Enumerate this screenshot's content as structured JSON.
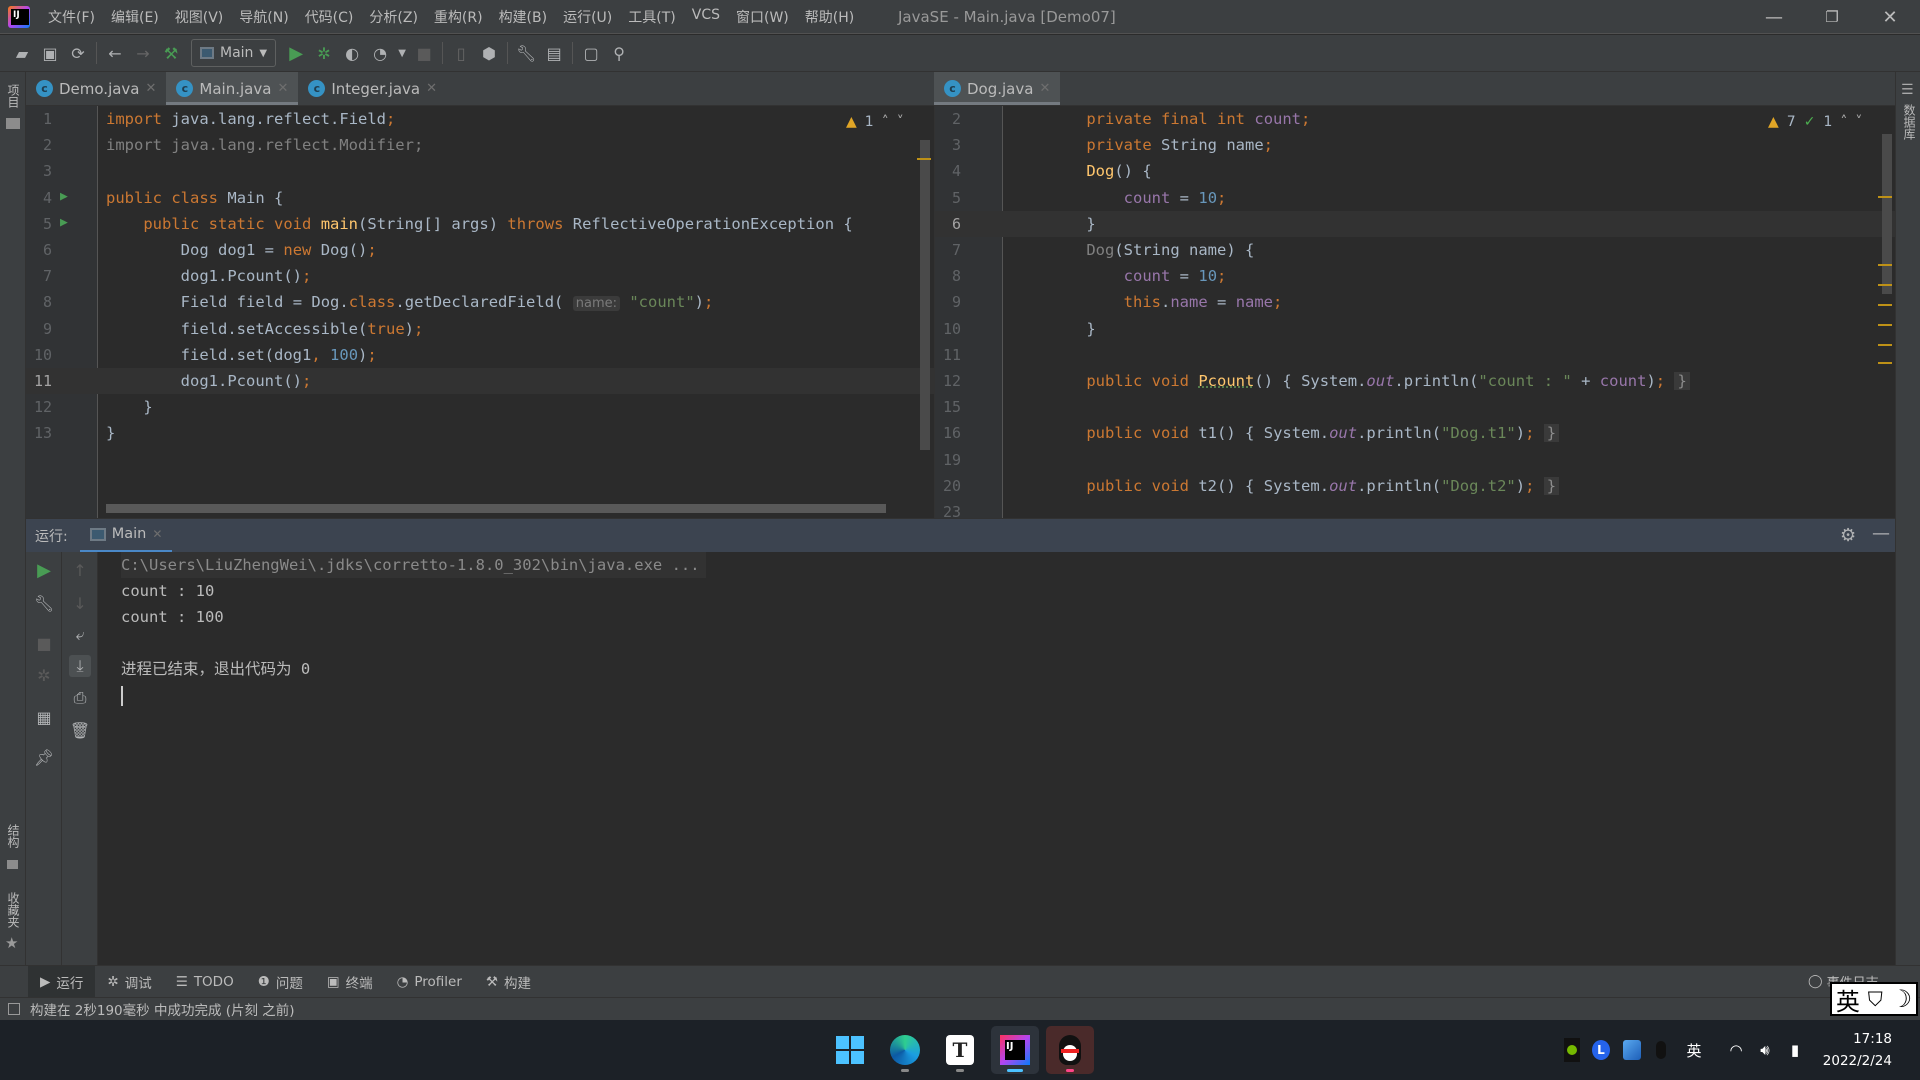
{
  "window": {
    "title": "JavaSE - Main.java [Demo07]",
    "controls": {
      "minimize": "—",
      "restore": "❐",
      "close": "✕"
    }
  },
  "menu": [
    "文件(F)",
    "编辑(E)",
    "视图(V)",
    "导航(N)",
    "代码(C)",
    "分析(Z)",
    "重构(R)",
    "构建(B)",
    "运行(U)",
    "工具(T)",
    "VCS",
    "窗口(W)",
    "帮助(H)"
  ],
  "toolbar": {
    "run_config": "Main"
  },
  "side_left": {
    "project": "项目",
    "structure": "结构",
    "favorites": "收藏夹"
  },
  "side_right": {
    "database": "数据库"
  },
  "left_editor": {
    "tabs": [
      {
        "label": "Demo.java",
        "active": false
      },
      {
        "label": "Main.java",
        "active": true
      },
      {
        "label": "Integer.java",
        "active": false
      }
    ],
    "inspections": {
      "warnings": "1"
    },
    "current_line": "11",
    "lines": [
      {
        "n": "1",
        "text": "import java.lang.reflect.Field;"
      },
      {
        "n": "2",
        "text": "import java.lang.reflect.Modifier;"
      },
      {
        "n": "3",
        "text": ""
      },
      {
        "n": "4",
        "text": "public class Main {"
      },
      {
        "n": "5",
        "text": "    public static void main(String[] args) throws ReflectiveOperationException {"
      },
      {
        "n": "6",
        "text": "        Dog dog1 = new Dog();"
      },
      {
        "n": "7",
        "text": "        dog1.Pcount();"
      },
      {
        "n": "8",
        "text": "        Field field = Dog.class.getDeclaredField( name: \"count\");"
      },
      {
        "n": "9",
        "text": "        field.setAccessible(true);"
      },
      {
        "n": "10",
        "text": "        field.set(dog1, 100);"
      },
      {
        "n": "11",
        "text": "        dog1.Pcount();"
      },
      {
        "n": "12",
        "text": "    }"
      },
      {
        "n": "13",
        "text": "}"
      }
    ],
    "param_hint": "name:"
  },
  "right_editor": {
    "tabs": [
      {
        "label": "Dog.java",
        "active": true
      }
    ],
    "inspections": {
      "warnings": "7",
      "typos": "1"
    },
    "current_line": "6",
    "lines": [
      {
        "n": "2",
        "text": "    private final int count;"
      },
      {
        "n": "3",
        "text": "    private String name;"
      },
      {
        "n": "4",
        "text": "    Dog() {"
      },
      {
        "n": "5",
        "text": "        count = 10;"
      },
      {
        "n": "6",
        "text": "    }"
      },
      {
        "n": "7",
        "text": "    Dog(String name) {"
      },
      {
        "n": "8",
        "text": "        count = 10;"
      },
      {
        "n": "9",
        "text": "        this.name = name;"
      },
      {
        "n": "10",
        "text": "    }"
      },
      {
        "n": "11",
        "text": ""
      },
      {
        "n": "12",
        "text": "    public void Pcount() { System.out.println(\"count : \" + count); }"
      },
      {
        "n": "15",
        "text": ""
      },
      {
        "n": "16",
        "text": "    public void t1() { System.out.println(\"Dog.t1\"); }"
      },
      {
        "n": "19",
        "text": ""
      },
      {
        "n": "20",
        "text": "    public void t2() { System.out.println(\"Dog.t2\"); }"
      },
      {
        "n": "23",
        "text": ""
      }
    ]
  },
  "run_panel": {
    "label": "运行:",
    "tab": "Main",
    "console": [
      "C:\\Users\\LiuZhengWei\\.jdks\\corretto-1.8.0_302\\bin\\java.exe ...",
      "count : 10",
      "count : 100",
      "",
      "进程已结束，退出代码为 0"
    ]
  },
  "bottom_tools": [
    {
      "label": "运行",
      "icon": "run-icon",
      "active": true
    },
    {
      "label": "调试",
      "icon": "debug-icon",
      "active": false
    },
    {
      "label": "TODO",
      "icon": "todo-icon",
      "active": false
    },
    {
      "label": "问题",
      "icon": "problems-icon",
      "active": false
    },
    {
      "label": "终端",
      "icon": "terminal-icon",
      "active": false
    },
    {
      "label": "Profiler",
      "icon": "profiler-icon",
      "active": false
    },
    {
      "label": "构建",
      "icon": "build-icon",
      "active": false
    }
  ],
  "event_log": "事件日志",
  "status": "构建在 2秒190毫秒 中成功完成 (片刻 之前)",
  "ime_overlay": {
    "lang": "英",
    "skin": "👕",
    "moon": "☽"
  },
  "taskbar": {
    "apps": [
      "windows-start",
      "edge",
      "typora",
      "intellij",
      "qq"
    ],
    "tray_lang": "英",
    "time": "17:18",
    "date": "2022/2/24"
  }
}
